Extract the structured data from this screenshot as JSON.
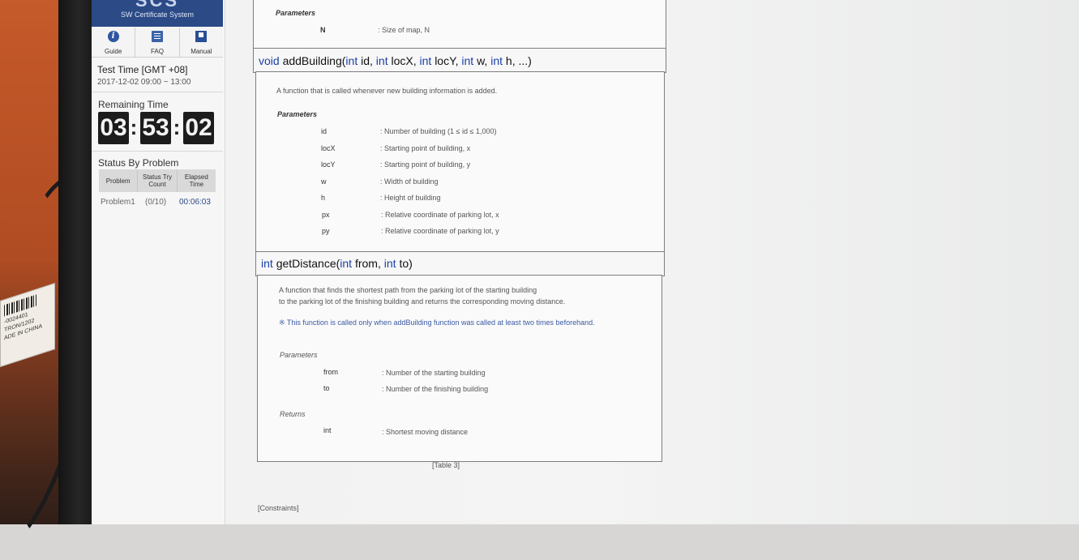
{
  "sidebar": {
    "logo": "SCS",
    "system_name": "SW Certificate System",
    "nav": [
      {
        "label": "Guide",
        "icon": "info-icon"
      },
      {
        "label": "FAQ",
        "icon": "list-icon"
      },
      {
        "label": "Manual",
        "icon": "book-icon"
      }
    ],
    "test_time_label": "Test Time [GMT +08]",
    "test_time_value": "2017-12-02 09:00 ~ 13:00",
    "remaining_label": "Remaining Time",
    "remaining": {
      "h": "03",
      "m": "53",
      "s": "02"
    },
    "status_title": "Status By Problem",
    "status_headers": [
      "Problem",
      "Status Try Count",
      "Elapsed Time"
    ],
    "status_rows": [
      {
        "problem": "Problem1",
        "count": "(0/10)",
        "elapsed": "00:06:03"
      }
    ]
  },
  "section_top": {
    "params_label": "Parameters",
    "param": {
      "name": "N",
      "desc": ": Size of map, N"
    }
  },
  "add_building": {
    "signature": {
      "ret": "void",
      "name": "addBuilding(",
      "p1t": "int",
      "p1": "id,",
      "p2t": "int",
      "p2": "locX,",
      "p3t": "int",
      "p3": "locY,",
      "p4t": "int",
      "p4": "w,",
      "p5t": "int",
      "p5": "h, ...)"
    },
    "description": "A function that is called whenever new building information is added.",
    "params_label": "Parameters",
    "params": [
      {
        "name": "id",
        "desc": ": Number of building (1 ≤ id ≤ 1,000)"
      },
      {
        "name": "locX",
        "desc": ": Starting point of building, x"
      },
      {
        "name": "locY",
        "desc": ": Starting point of building, y"
      },
      {
        "name": "w",
        "desc": ": Width of building"
      },
      {
        "name": "h",
        "desc": ": Height of building"
      },
      {
        "name": "px",
        "desc": ": Relative coordinate of parking lot, x"
      },
      {
        "name": "py",
        "desc": ": Relative coordinate of parking lot, y"
      }
    ]
  },
  "get_distance": {
    "signature": {
      "ret": "int",
      "name": "getDistance(",
      "p1t": "int",
      "p1": "from,",
      "p2t": "int",
      "p2": "to)"
    },
    "description_lines": [
      "A function that finds the shortest path from the parking lot of the starting building",
      "to the parking lot of the finishing building and returns the corresponding moving distance."
    ],
    "note": "※ This function is called only when addBuilding function was called at least two times beforehand.",
    "params_label": "Parameters",
    "params": [
      {
        "name": "from",
        "desc": ": Number of the starting building"
      },
      {
        "name": "to",
        "desc": ": Number of the finishing building"
      }
    ],
    "returns_label": "Returns",
    "returns": [
      {
        "name": "int",
        "desc": ": Shortest moving distance"
      }
    ]
  },
  "table_caption": "[Table 3]",
  "constraints_label": "[Constraints]",
  "sticker": {
    "line1": "-0024401",
    "line2": "TRON/1202",
    "line3": "ADE IN CHINA"
  },
  "colors": {
    "brand": "#2b4a86",
    "keyword": "#1b3fa6",
    "timer_bg": "#1c1c1c"
  }
}
